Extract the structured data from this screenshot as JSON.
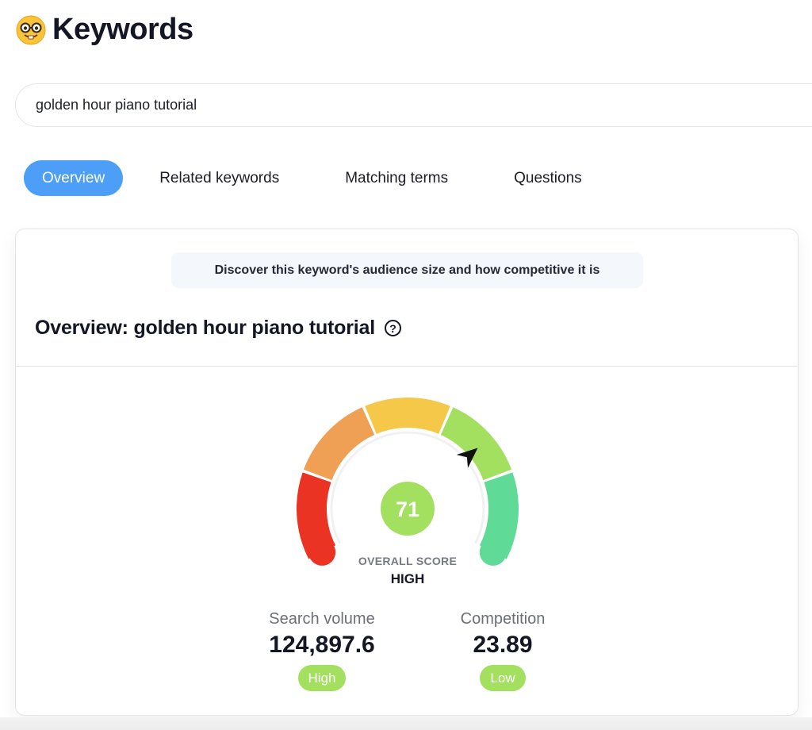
{
  "header": {
    "emoji_icon": "nerd-face",
    "title": "Keywords"
  },
  "search": {
    "value": "golden hour piano tutorial",
    "placeholder": ""
  },
  "tabs": [
    {
      "label": "Overview",
      "active": true
    },
    {
      "label": "Related keywords",
      "active": false
    },
    {
      "label": "Matching terms",
      "active": false
    },
    {
      "label": "Questions",
      "active": false
    }
  ],
  "card": {
    "hint": "Discover this keyword's audience size and how competitive it is",
    "title": "Overview: golden hour piano tutorial",
    "help_icon": "question-circle"
  },
  "gauge": {
    "score": 71,
    "score_range": [
      0,
      100
    ],
    "score_label": "OVERALL SCORE",
    "score_level": "HIGH",
    "score_color": "#a3e05f",
    "segments": [
      {
        "color": "#ea3323"
      },
      {
        "color": "#f0a055"
      },
      {
        "color": "#f6c84a"
      },
      {
        "color": "#a3e05f"
      },
      {
        "color": "#5fdb97"
      }
    ]
  },
  "metrics": [
    {
      "label": "Search volume",
      "value": "124,897.6",
      "badge": "High",
      "badge_color": "#a3e05f"
    },
    {
      "label": "Competition",
      "value": "23.89",
      "badge": "Low",
      "badge_color": "#a3e05f"
    }
  ]
}
